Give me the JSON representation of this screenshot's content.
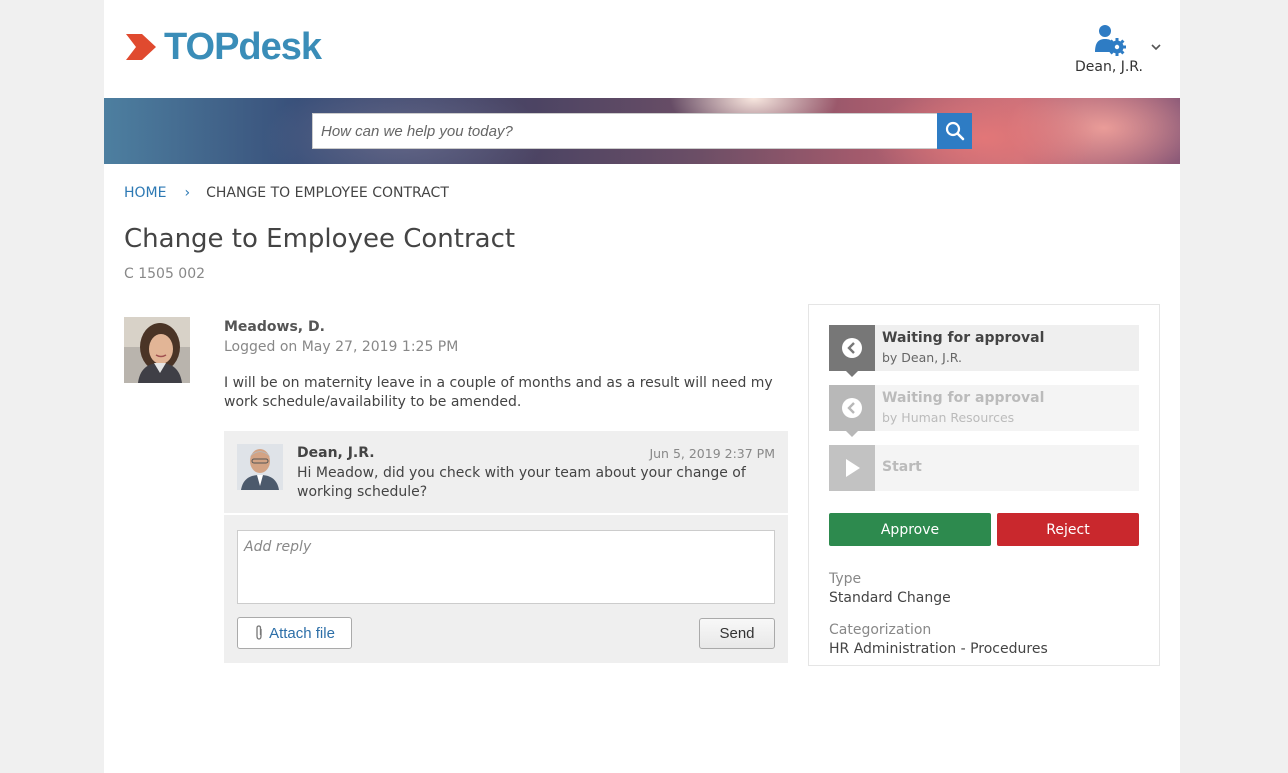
{
  "header": {
    "logo_text": "TOPdesk",
    "user_name": "Dean, J.R.",
    "brand_color": "#3a8db8",
    "logo_mark_color": "#e04a2f"
  },
  "search": {
    "placeholder": "How can we help you today?",
    "button_icon": "search-icon"
  },
  "breadcrumb": {
    "home": "HOME",
    "separator": "›",
    "current": "CHANGE TO EMPLOYEE CONTRACT"
  },
  "request": {
    "title": "Change to Employee Contract",
    "number": "C 1505 002",
    "author": "Meadows, D.",
    "logged": "Logged on May 27, 2019 1:25 PM",
    "description": "I will be on maternity leave in a couple of months and as a result will need my work schedule/availability to be amended."
  },
  "comments": [
    {
      "author": "Dean, J.R.",
      "timestamp": "Jun 5, 2019 2:37 PM",
      "text": "Hi Meadow, did you check with your team about your change of working schedule?"
    }
  ],
  "reply": {
    "placeholder": "Add reply",
    "attach_label": "Attach file",
    "send_label": "Send"
  },
  "workflow": {
    "steps": [
      {
        "title": "Waiting for approval",
        "subtitle": "by Dean, J.R.",
        "state": "active",
        "icon": "clock-icon"
      },
      {
        "title": "Waiting for approval",
        "subtitle": "by Human Resources",
        "state": "pending",
        "icon": "clock-icon"
      },
      {
        "title": "Start",
        "subtitle": "",
        "state": "pending",
        "icon": "play-icon"
      }
    ],
    "approve_label": "Approve",
    "reject_label": "Reject",
    "approve_color": "#2d8a4e",
    "reject_color": "#c9282d"
  },
  "details": {
    "type_label": "Type",
    "type_value": "Standard Change",
    "category_label": "Categorization",
    "category_value": "HR Administration - Procedures"
  }
}
